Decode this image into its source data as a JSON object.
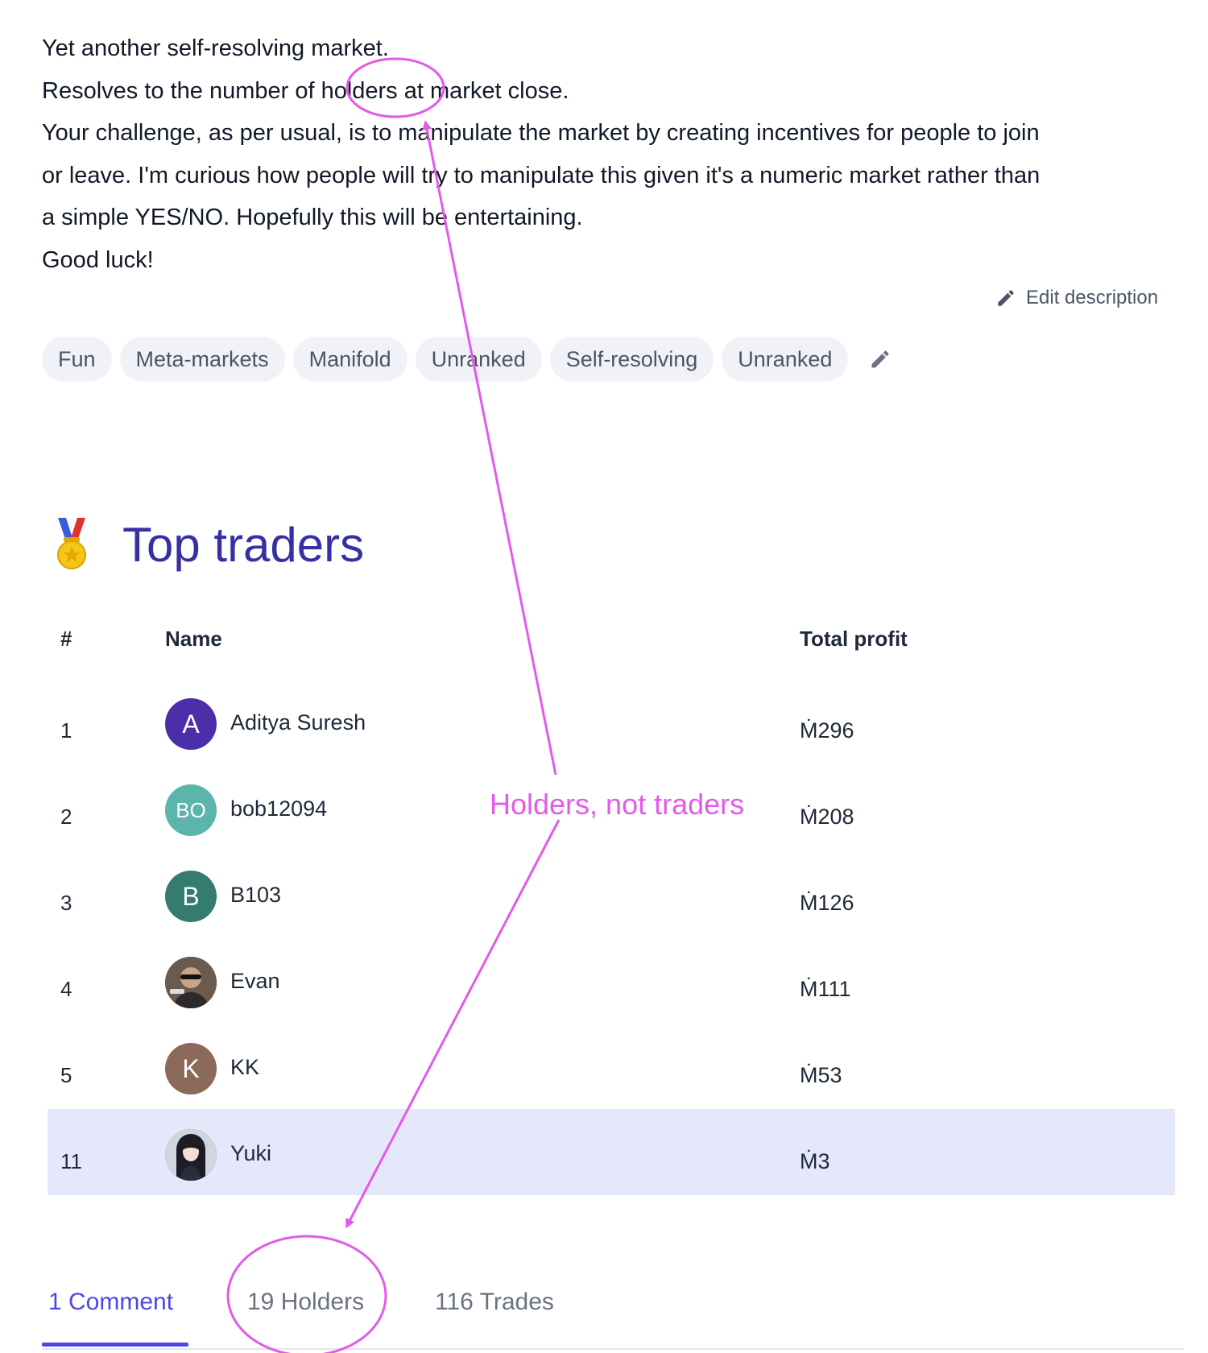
{
  "description": {
    "lines": [
      "Yet another self-resolving market.",
      "Resolves to the number of holders at market close.",
      "Your challenge, as per usual, is to manipulate the market by creating incentives for people to join",
      "or leave. I'm curious how people will try to manipulate this given it's a numeric market rather than",
      "a simple YES/NO. Hopefully this will be entertaining.",
      "Good luck!"
    ],
    "edit_label": "Edit description"
  },
  "tags": [
    "Fun",
    "Meta-markets",
    "Manifold",
    "Unranked",
    "Self-resolving",
    "Unranked"
  ],
  "top_traders": {
    "title": "Top traders",
    "columns": {
      "rank": "#",
      "name": "Name",
      "profit": "Total profit"
    },
    "rows": [
      {
        "rank": "1",
        "name": "Aditya Suresh",
        "initials": "A",
        "avatar_color": "#4c2fa8",
        "profit": "Ṁ296"
      },
      {
        "rank": "2",
        "name": "bob12094",
        "initials": "BO",
        "avatar_color": "#5bb5aa",
        "profit": "Ṁ208"
      },
      {
        "rank": "3",
        "name": "B103",
        "initials": "B",
        "avatar_color": "#347c6e",
        "profit": "Ṁ126"
      },
      {
        "rank": "4",
        "name": "Evan",
        "initials": "",
        "avatar_color": "#5a4a40",
        "profit": "Ṁ111"
      },
      {
        "rank": "5",
        "name": "KK",
        "initials": "K",
        "avatar_color": "#8b6a5c",
        "profit": "Ṁ53"
      },
      {
        "rank": "11",
        "name": "Yuki",
        "initials": "",
        "avatar_color": "#4a5060",
        "profit": "Ṁ3"
      }
    ]
  },
  "tabs": [
    {
      "label": "1 Comment",
      "active": true
    },
    {
      "label": "19 Holders",
      "active": false
    },
    {
      "label": "116 Trades",
      "active": false
    }
  ],
  "annotation": {
    "text": "Holders, not traders",
    "color": "#e35ae9"
  },
  "colors": {
    "accent": "#4f46e5",
    "title": "#3730a3",
    "highlight_row": "#e5e7fa",
    "tag_bg": "#f1f2f7"
  }
}
